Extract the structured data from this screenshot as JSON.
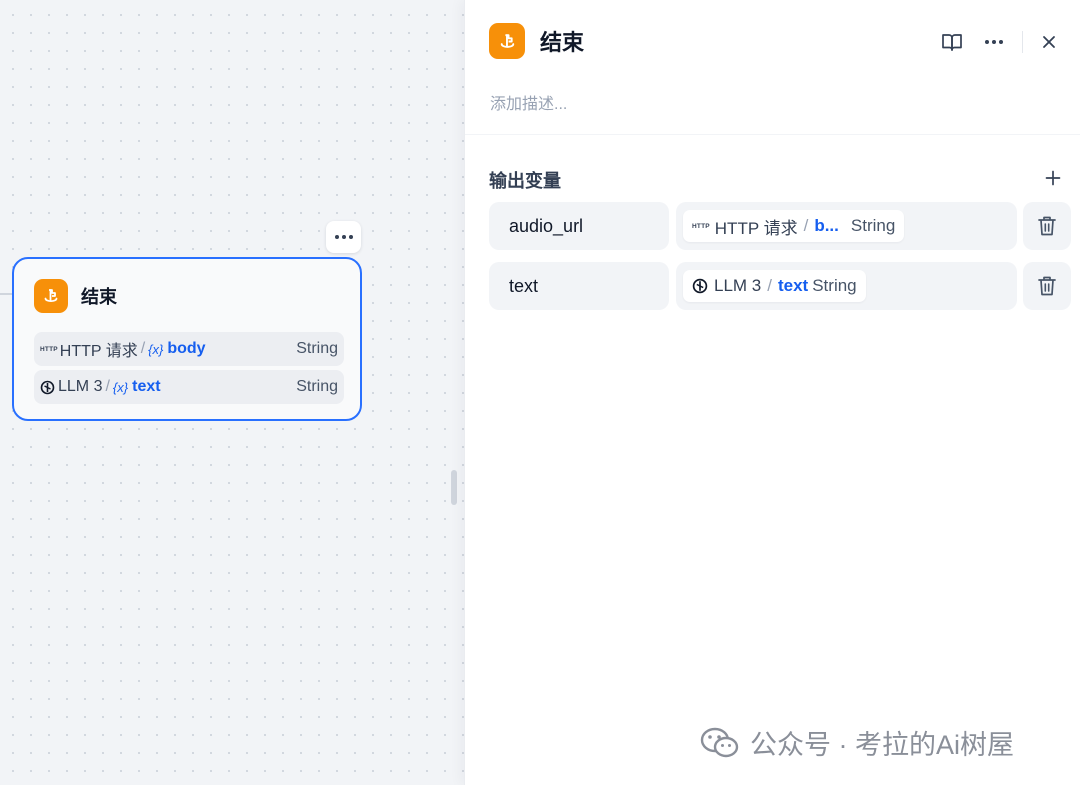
{
  "canvas_node": {
    "title": "结束",
    "icon": "end-node-icon",
    "rows": [
      {
        "source_icon": "HTTP",
        "source": "HTTP 请求",
        "var_symbol": "{x}",
        "var": "body",
        "type": "String"
      },
      {
        "source_icon": "llm-icon",
        "source": "LLM 3",
        "var_symbol": "{x}",
        "var": "text",
        "type": "String"
      }
    ]
  },
  "panel": {
    "title": "结束",
    "description_placeholder": "添加描述...",
    "section_title": "输出变量",
    "outputs": [
      {
        "name": "audio_url",
        "source_icon": "HTTP",
        "source": "HTTP 请求",
        "var": "b...",
        "type": "String"
      },
      {
        "name": "text",
        "source_icon": "llm-icon",
        "source": "LLM 3",
        "var": "text",
        "type": "String"
      }
    ]
  },
  "colors": {
    "accent": "#2970ff",
    "node_icon": "#f79009",
    "variable": "#155eef"
  },
  "watermark": {
    "text": "公众号 · 考拉的Ai树屋"
  }
}
